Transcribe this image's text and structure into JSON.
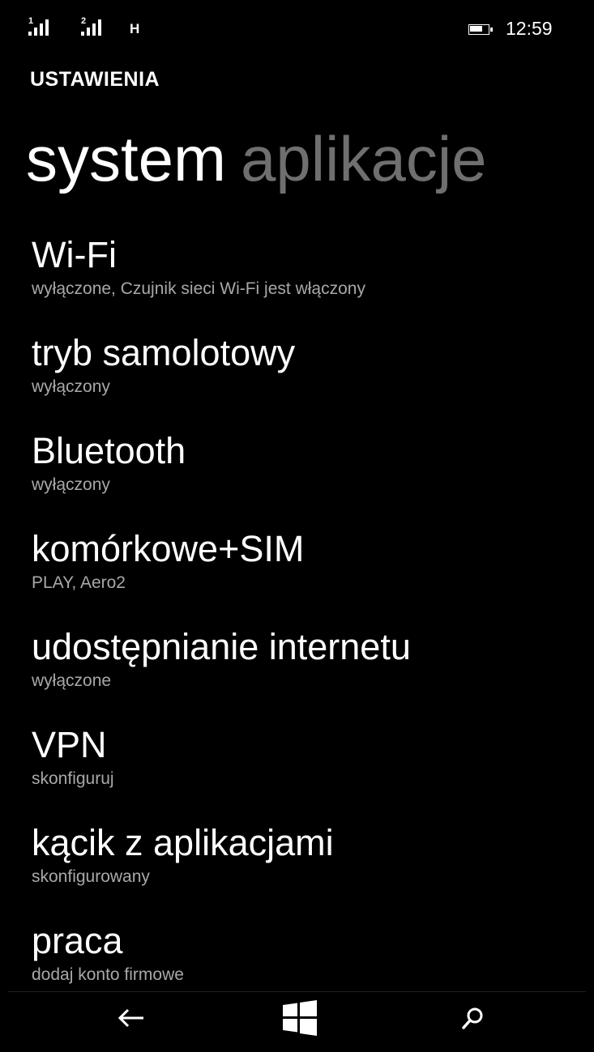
{
  "status_bar": {
    "sim1_label": "1",
    "sim2_label": "2",
    "network_type": "H",
    "clock": "12:59",
    "battery_level": 0.7
  },
  "header": {
    "app_title": "USTAWIENIA",
    "pivot_tabs": [
      {
        "label": "system",
        "active": true
      },
      {
        "label": "aplikacje",
        "active": false
      }
    ]
  },
  "settings": [
    {
      "title": "Wi-Fi",
      "subtitle": "wyłączone, Czujnik sieci Wi-Fi jest włączony"
    },
    {
      "title": "tryb samolotowy",
      "subtitle": "wyłączony"
    },
    {
      "title": "Bluetooth",
      "subtitle": "wyłączony"
    },
    {
      "title": "komórkowe+SIM",
      "subtitle": "PLAY, Aero2"
    },
    {
      "title": "udostępnianie internetu",
      "subtitle": "wyłączone"
    },
    {
      "title": "VPN",
      "subtitle": "skonfiguruj"
    },
    {
      "title": "kącik z aplikacjami",
      "subtitle": "skonfigurowany"
    },
    {
      "title": "praca",
      "subtitle": "dodaj konto firmowe"
    }
  ],
  "app_bar": {
    "buttons": [
      {
        "icon": "back-arrow-icon"
      },
      {
        "icon": "windows-start-icon"
      },
      {
        "icon": "search-icon"
      }
    ]
  },
  "colors": {
    "background": "#000000",
    "text_primary": "#ffffff",
    "text_secondary": "#a8a8a8",
    "pivot_inactive": "#6f6f6f"
  }
}
